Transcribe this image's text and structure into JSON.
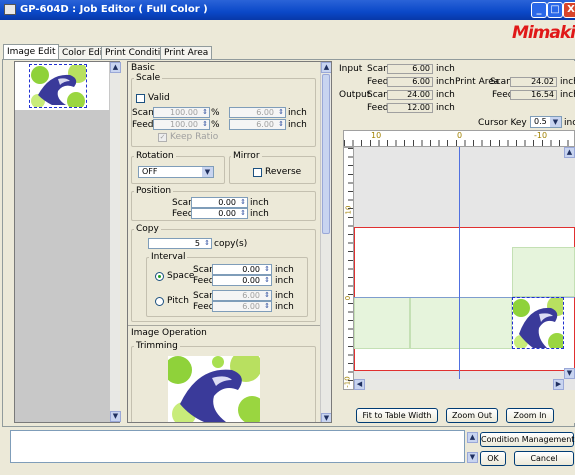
{
  "window": {
    "title": "GP-604D : Job Editor ( Full Color )",
    "buttons": {
      "minimize": "_",
      "maximize": "□",
      "close": "X"
    }
  },
  "logo": "Mimaki",
  "tabs": [
    "Image Edit",
    "Color Edit",
    "Print Condition",
    "Print Area"
  ],
  "basic": {
    "title": "Basic",
    "scale": {
      "legend": "Scale",
      "valid_label": "Valid",
      "scan_label": "Scan",
      "feed_label": "Feed",
      "scan_pct": "100.00",
      "feed_pct": "100.00",
      "pct_unit": "%",
      "scan_inch": "6.00",
      "feed_inch": "6.00",
      "inch_unit": "inch",
      "keep_ratio": "Keep Ratio"
    },
    "rotation": {
      "legend": "Rotation",
      "value": "OFF"
    },
    "mirror": {
      "legend": "Mirror",
      "reverse": "Reverse"
    },
    "position": {
      "legend": "Position",
      "scan_label": "Scan",
      "feed_label": "Feed",
      "scan": "0.00",
      "feed": "0.00",
      "unit": "inch"
    },
    "copy": {
      "legend": "Copy",
      "count": "5",
      "unit": "copy(s)",
      "interval": {
        "legend": "Interval",
        "space_label": "Space",
        "pitch_label": "Pitch",
        "scan_label": "Scan",
        "feed_label": "Feed",
        "space_scan": "0.00",
        "space_feed": "0.00",
        "pitch_scan": "6.00",
        "pitch_feed": "6.00",
        "unit": "inch"
      }
    }
  },
  "image_operation": {
    "title": "Image Operation",
    "trimming": "Trimming"
  },
  "info": {
    "input_label": "Input",
    "output_label": "Output",
    "scan_label": "Scan",
    "feed_label": "Feed",
    "unit": "inch",
    "input_scan": "6.00",
    "input_feed": "6.00",
    "output_scan": "24.00",
    "output_feed": "12.00",
    "print_area_label": "Print Area",
    "print_area_scan": "24.02",
    "print_area_feed": "16.54"
  },
  "cursor_key_unit": {
    "label": "Cursor Key Unit",
    "value": "0.5",
    "unit": "inch"
  },
  "ruler": {
    "h_labels": [
      "10",
      "0",
      "-10"
    ],
    "v_labels": [
      "10",
      "0",
      "-10"
    ]
  },
  "canvas_buttons": {
    "fit": "Fit to Table Width",
    "zoom_out": "Zoom Out",
    "zoom_in": "Zoom In"
  },
  "bottom": {
    "condition_management": "Condition Management",
    "ok": "OK",
    "cancel": "Cancel"
  },
  "colors": {
    "title_bar": "#0a48c8",
    "accent_red": "#e01818",
    "print_area_border": "#e03030",
    "axis_line": "#5070e0"
  }
}
